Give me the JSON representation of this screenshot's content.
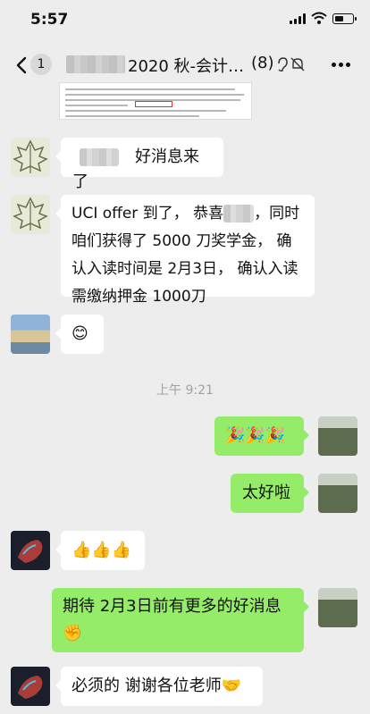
{
  "status_bar": {
    "time": "5:57"
  },
  "nav": {
    "unread_count": "1",
    "title": "2020 秋-会计…",
    "member_count": "(8)"
  },
  "messages": [
    {
      "side": "left",
      "text": "好消息来了"
    },
    {
      "side": "left",
      "text": "UCI offer 到了， 恭喜",
      "text_2": "，同时咱们获得了 5000 刀奖学金， 确认入读时间是 2月3日， 确认入读需缴纳押金 1000刀"
    },
    {
      "side": "left",
      "text": "😊"
    },
    {
      "side": "right",
      "text": "🎉🎉🎉"
    },
    {
      "side": "right",
      "text": "太好啦"
    },
    {
      "side": "left",
      "text": "👍👍👍"
    },
    {
      "side": "right",
      "text": "期待 2月3日前有更多的好消息✊"
    },
    {
      "side": "left",
      "text": "必须的 谢谢各位老师🤝"
    }
  ],
  "timestamp": "上午 9:21",
  "colors": {
    "background": "#ededed",
    "self_bubble": "#95ec69",
    "other_bubble": "#ffffff"
  },
  "icons": [
    "back-icon",
    "ear-icon",
    "mute-icon",
    "more-icon",
    "signal-icon",
    "wifi-icon",
    "battery-icon"
  ]
}
